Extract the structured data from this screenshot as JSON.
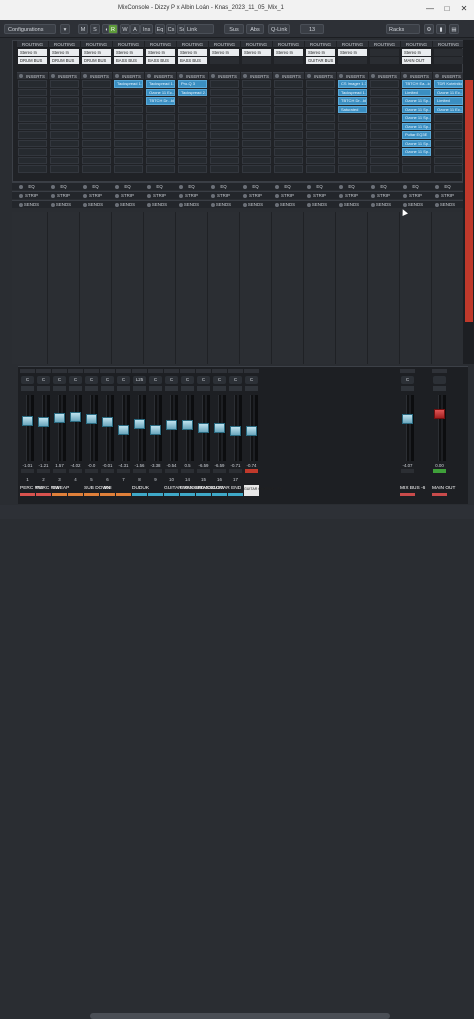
{
  "window": {
    "title": "MixConsole - Dizzy P x Albin Loán - Knas_2023_11_05_Mix_1",
    "min": "—",
    "max": "□",
    "close": "✕"
  },
  "toolbar": {
    "configurations": "Configurations",
    "r": "R",
    "w": "W",
    "a": "A",
    "m": "M",
    "s": "S",
    "ins": "Ins",
    "eq": "Eq",
    "cs": "Cs",
    "sd": "Sd",
    "link": "Link",
    "sus": "Sus",
    "abs": "Abs",
    "qlink": "Q-Link",
    "count": "13",
    "racks": "Racks"
  },
  "routing_label": "ROUTING",
  "inserts_label": "INSERTS",
  "eq_label": "EQ",
  "strip_label": "STRIP",
  "sends_label": "SENDS",
  "channels": [
    {
      "in": "Stereo In",
      "out": "DRUM BUS",
      "inserts": []
    },
    {
      "in": "Stereo In",
      "out": "DRUM BUS",
      "inserts": []
    },
    {
      "in": "Stereo In",
      "out": "DRUM BUS",
      "inserts": []
    },
    {
      "in": "Stereo In",
      "out": "BASS BUS",
      "inserts": [
        "Tackspread 1.3"
      ]
    },
    {
      "in": "Stereo In",
      "out": "BASS BUS",
      "inserts": [
        "Tackspread 1.3",
        "Ozone 11 Ec...ui",
        "TBTCH Dr...ldr"
      ]
    },
    {
      "in": "Stereo In",
      "out": "BASS BUS",
      "inserts": [
        "Pro-Q 3",
        "Tackspread 2.3"
      ]
    },
    {
      "in": "Stereo In",
      "out": "",
      "inserts": []
    },
    {
      "in": "Stereo In",
      "out": "",
      "inserts": []
    },
    {
      "in": "Stereo In",
      "out": "",
      "inserts": []
    },
    {
      "in": "Stereo In",
      "out": "GUITAR BUS",
      "inserts": []
    },
    {
      "in": "Stereo In",
      "out": "",
      "inserts": [
        "CS Imager 1.3",
        "Tackspread 1.3",
        "TBTCH Dr...ldr",
        "Saturated"
      ]
    },
    {
      "in": "",
      "out": "",
      "inserts": []
    },
    {
      "in": "Stereo In",
      "out": "MAIN OUT",
      "inserts": [
        "TBTCH Ea...ldr",
        "Limited",
        "Ozone 11 Sp...r",
        "Ozone 11 Sp...r",
        "Ozone 11 Sp...r",
        "Ozone 11 Sp...r",
        "Pultar EQ3E",
        "Ozone 11 Sp...r",
        "Ozone 11 Sp...r"
      ]
    },
    {
      "in": "",
      "out": "",
      "inserts": [
        "TDR Kotelnikov",
        "Ozone 11 Ec...ui",
        "Limited",
        "Ozone 11 Ec...ui"
      ]
    }
  ],
  "faders": [
    {
      "name": "PERC R55",
      "val": "-1.01",
      "num": "1",
      "pan": "C",
      "color": "#d9534f",
      "level": 0.62
    },
    {
      "name": "PERC R86",
      "val": "-1.21",
      "num": "2",
      "pan": "C",
      "color": "#d9534f",
      "level": 0.6
    },
    {
      "name": "SWEAP",
      "val": "1.57",
      "num": "3",
      "pan": "C",
      "color": "#e0803a",
      "level": 0.68
    },
    {
      "name": "",
      "val": "-4.02",
      "num": "4",
      "pan": "C",
      "color": "#e0803a",
      "level": 0.7
    },
    {
      "name": "SUB DOWN",
      "val": "-0.0",
      "num": "5",
      "pan": "C",
      "color": "#e0803a",
      "level": 0.66
    },
    {
      "name": "808",
      "val": "-0.01",
      "num": "6",
      "pan": "C",
      "color": "#e0803a",
      "level": 0.6
    },
    {
      "name": "",
      "val": "-4.31",
      "num": "7",
      "pan": "C",
      "color": "#e0803a",
      "level": 0.46
    },
    {
      "name": "DUDUK",
      "val": "-1.56",
      "num": "8",
      "pan": "L25",
      "color": "#3fa9c9",
      "level": 0.58
    },
    {
      "name": "",
      "val": "-3.38",
      "num": "9",
      "pan": "C",
      "color": "#3fa9c9",
      "level": 0.46
    },
    {
      "name": "GUITAR VERSES",
      "val": "-0.54",
      "num": "10",
      "pan": "C",
      "color": "#3fa9c9",
      "level": 0.55
    },
    {
      "name": "BRASS ATMOS",
      "val": "0.5",
      "num": "14",
      "pan": "C",
      "color": "#3fa9c9",
      "level": 0.55
    },
    {
      "name": "BRASS LOW",
      "val": "-6.59",
      "num": "15",
      "pan": "C",
      "color": "#3fa9c9",
      "level": 0.5
    },
    {
      "name": "GUITAR END",
      "val": "-6.59",
      "num": "16",
      "pan": "C",
      "color": "#3fa9c9",
      "level": 0.5
    },
    {
      "name": "",
      "val": "-0.71",
      "num": "17",
      "pan": "C",
      "color": "#3fa9c9",
      "level": 0.45
    },
    {
      "name": "GUITAR CHORUS - FX",
      "val": "-0.74",
      "num": "",
      "pan": "C",
      "color": "#e8e8e8",
      "level": 0.45
    },
    {
      "name": "MIX BUS -6",
      "val": "-4.07",
      "num": "",
      "pan": "C",
      "color": "#c94b4b",
      "level": 0.66
    },
    {
      "name": "MAIN OUT",
      "val": "0.00",
      "num": "",
      "pan": "",
      "color": "#c94b4b",
      "level": 0.75
    }
  ]
}
